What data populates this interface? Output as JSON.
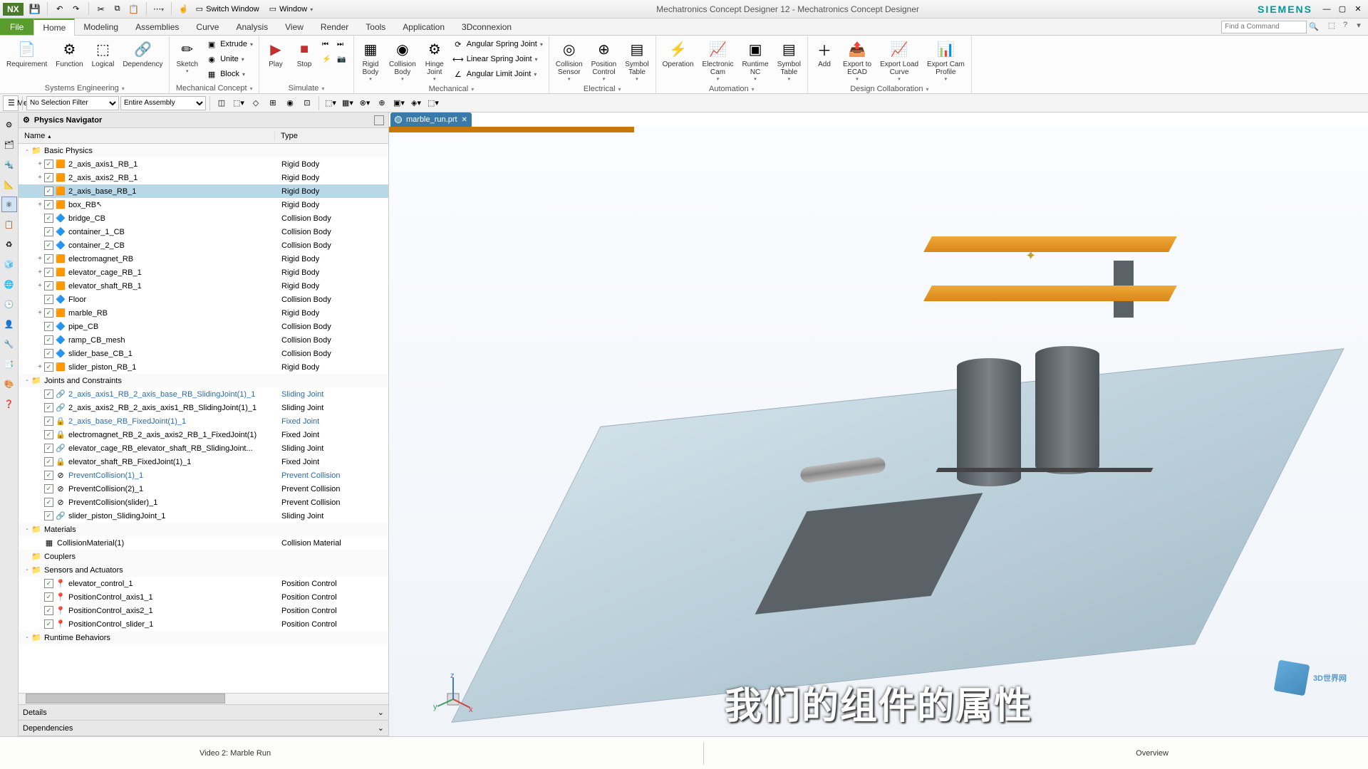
{
  "titlebar": {
    "logo": "NX",
    "switch_window": "Switch Window",
    "window_menu": "Window",
    "app_title": "Mechatronics Concept Designer 12 - Mechatronics Concept Designer",
    "brand": "SIEMENS"
  },
  "menu": {
    "file": "File",
    "tabs": [
      "Home",
      "Modeling",
      "Assemblies",
      "Curve",
      "Analysis",
      "View",
      "Render",
      "Tools",
      "Application",
      "3Dconnexion"
    ],
    "active_tab": "Home",
    "search_placeholder": "Find a Command"
  },
  "ribbon": {
    "groups": [
      {
        "title": "Systems Engineering",
        "buttons": [
          {
            "label": "Requirement",
            "icon": "📄"
          },
          {
            "label": "Function",
            "icon": "⚙"
          },
          {
            "label": "Logical",
            "icon": "⬚"
          },
          {
            "label": "Dependency",
            "icon": "🔗"
          }
        ]
      },
      {
        "title": "Mechanical Concept",
        "buttons": [
          {
            "label": "Sketch",
            "icon": "✏",
            "arrow": true
          }
        ],
        "smalls": [
          {
            "label": "Extrude",
            "icon": "▣"
          },
          {
            "label": "Unite",
            "icon": "◉"
          },
          {
            "label": "Block",
            "icon": "▦"
          }
        ]
      },
      {
        "title": "Simulate",
        "buttons": [
          {
            "label": "Play",
            "icon": "▶",
            "color": "#c03030"
          },
          {
            "label": "Stop",
            "icon": "■",
            "color": "#c03030"
          }
        ],
        "extra_icons": [
          "⏮",
          "⏭",
          "⚡",
          "📷"
        ]
      },
      {
        "title": "Mechanical",
        "buttons": [
          {
            "label": "Rigid\nBody",
            "icon": "▦",
            "arrow": true
          },
          {
            "label": "Collision\nBody",
            "icon": "◉",
            "arrow": true
          },
          {
            "label": "Hinge\nJoint",
            "icon": "⚙",
            "arrow": true
          }
        ],
        "smalls": [
          {
            "label": "Angular Spring Joint",
            "icon": "⟳"
          },
          {
            "label": "Linear Spring Joint",
            "icon": "⟷"
          },
          {
            "label": "Angular Limit Joint",
            "icon": "∠"
          }
        ]
      },
      {
        "title": "Electrical",
        "buttons": [
          {
            "label": "Collision\nSensor",
            "icon": "◎",
            "arrow": true
          },
          {
            "label": "Position\nControl",
            "icon": "⊕",
            "arrow": true
          },
          {
            "label": "Symbol\nTable",
            "icon": "▤",
            "arrow": true
          }
        ]
      },
      {
        "title": "Automation",
        "buttons": [
          {
            "label": "Operation",
            "icon": "⚡"
          },
          {
            "label": "Electronic\nCam",
            "icon": "📈",
            "arrow": true
          },
          {
            "label": "Runtime\nNC",
            "icon": "▣",
            "arrow": true
          },
          {
            "label": "Symbol\nTable",
            "icon": "▤",
            "arrow": true
          }
        ]
      },
      {
        "title": "Design Collaboration",
        "buttons": [
          {
            "label": "Add",
            "icon": "＋"
          },
          {
            "label": "Export to\nECAD",
            "icon": "📤",
            "arrow": true
          },
          {
            "label": "Export Load\nCurve",
            "icon": "📈",
            "arrow": true
          },
          {
            "label": "Export Cam\nProfile",
            "icon": "📊",
            "arrow": true
          }
        ]
      }
    ]
  },
  "subtoolbar": {
    "menu_label": "Menu",
    "filter": "No Selection Filter",
    "assembly": "Entire Assembly"
  },
  "navigator": {
    "title": "Physics Navigator",
    "col_name": "Name",
    "col_type": "Type",
    "details": "Details",
    "dependencies": "Dependencies",
    "tree": [
      {
        "kind": "folder",
        "name": "Basic Physics",
        "depth": 0,
        "expand": "-"
      },
      {
        "kind": "item",
        "name": "2_axis_axis1_RB_1",
        "type": "Rigid Body",
        "depth": 1,
        "icon": "🟧",
        "expand": "+"
      },
      {
        "kind": "item",
        "name": "2_axis_axis2_RB_1",
        "type": "Rigid Body",
        "depth": 1,
        "icon": "🟧",
        "expand": "+"
      },
      {
        "kind": "item",
        "name": "2_axis_base_RB_1",
        "type": "Rigid Body",
        "depth": 1,
        "icon": "🟧",
        "selected": true
      },
      {
        "kind": "item",
        "name": "box_RB",
        "type": "Rigid Body",
        "depth": 1,
        "icon": "🟧",
        "expand": "+",
        "cursor": true
      },
      {
        "kind": "item",
        "name": "bridge_CB",
        "type": "Collision Body",
        "depth": 1,
        "icon": "🔷"
      },
      {
        "kind": "item",
        "name": "container_1_CB",
        "type": "Collision Body",
        "depth": 1,
        "icon": "🔷"
      },
      {
        "kind": "item",
        "name": "container_2_CB",
        "type": "Collision Body",
        "depth": 1,
        "icon": "🔷"
      },
      {
        "kind": "item",
        "name": "electromagnet_RB",
        "type": "Rigid Body",
        "depth": 1,
        "icon": "🟧",
        "expand": "+"
      },
      {
        "kind": "item",
        "name": "elevator_cage_RB_1",
        "type": "Rigid Body",
        "depth": 1,
        "icon": "🟧",
        "expand": "+"
      },
      {
        "kind": "item",
        "name": "elevator_shaft_RB_1",
        "type": "Rigid Body",
        "depth": 1,
        "icon": "🟧",
        "expand": "+"
      },
      {
        "kind": "item",
        "name": "Floor",
        "type": "Collision Body",
        "depth": 1,
        "icon": "🔷"
      },
      {
        "kind": "item",
        "name": "marble_RB",
        "type": "Rigid Body",
        "depth": 1,
        "icon": "🟧",
        "expand": "+"
      },
      {
        "kind": "item",
        "name": "pipe_CB",
        "type": "Collision Body",
        "depth": 1,
        "icon": "🔷"
      },
      {
        "kind": "item",
        "name": "ramp_CB_mesh",
        "type": "Collision Body",
        "depth": 1,
        "icon": "🔷"
      },
      {
        "kind": "item",
        "name": "slider_base_CB_1",
        "type": "Collision Body",
        "depth": 1,
        "icon": "🔷"
      },
      {
        "kind": "item",
        "name": "slider_piston_RB_1",
        "type": "Rigid Body",
        "depth": 1,
        "icon": "🟧",
        "expand": "+"
      },
      {
        "kind": "folder",
        "name": "Joints and Constraints",
        "depth": 0,
        "expand": "-"
      },
      {
        "kind": "item",
        "name": "2_axis_axis1_RB_2_axis_base_RB_SlidingJoint(1)_1",
        "type": "Sliding Joint",
        "depth": 1,
        "icon": "🔗",
        "link": true
      },
      {
        "kind": "item",
        "name": "2_axis_axis2_RB_2_axis_axis1_RB_SlidingJoint(1)_1",
        "type": "Sliding Joint",
        "depth": 1,
        "icon": "🔗"
      },
      {
        "kind": "item",
        "name": "2_axis_base_RB_FixedJoint(1)_1",
        "type": "Fixed Joint",
        "depth": 1,
        "icon": "🔒",
        "link": true
      },
      {
        "kind": "item",
        "name": "electromagnet_RB_2_axis_axis2_RB_1_FixedJoint(1)",
        "type": "Fixed Joint",
        "depth": 1,
        "icon": "🔒"
      },
      {
        "kind": "item",
        "name": "elevator_cage_RB_elevator_shaft_RB_SlidingJoint...",
        "type": "Sliding Joint",
        "depth": 1,
        "icon": "🔗"
      },
      {
        "kind": "item",
        "name": "elevator_shaft_RB_FixedJoint(1)_1",
        "type": "Fixed Joint",
        "depth": 1,
        "icon": "🔒"
      },
      {
        "kind": "item",
        "name": "PreventCollision(1)_1",
        "type": "Prevent Collision",
        "depth": 1,
        "icon": "⊘",
        "link": true
      },
      {
        "kind": "item",
        "name": "PreventCollision(2)_1",
        "type": "Prevent Collision",
        "depth": 1,
        "icon": "⊘"
      },
      {
        "kind": "item",
        "name": "PreventCollision(slider)_1",
        "type": "Prevent Collision",
        "depth": 1,
        "icon": "⊘"
      },
      {
        "kind": "item",
        "name": "slider_piston_SlidingJoint_1",
        "type": "Sliding Joint",
        "depth": 1,
        "icon": "🔗"
      },
      {
        "kind": "folder",
        "name": "Materials",
        "depth": 0,
        "expand": "-"
      },
      {
        "kind": "item",
        "name": "CollisionMaterial(1)",
        "type": "Collision Material",
        "depth": 1,
        "icon": "▦",
        "nocheck": true
      },
      {
        "kind": "folder",
        "name": "Couplers",
        "depth": 0
      },
      {
        "kind": "folder",
        "name": "Sensors and Actuators",
        "depth": 0,
        "expand": "-"
      },
      {
        "kind": "item",
        "name": "elevator_control_1",
        "type": "Position Control",
        "depth": 1,
        "icon": "📍"
      },
      {
        "kind": "item",
        "name": "PositionControl_axis1_1",
        "type": "Position Control",
        "depth": 1,
        "icon": "📍"
      },
      {
        "kind": "item",
        "name": "PositionControl_axis2_1",
        "type": "Position Control",
        "depth": 1,
        "icon": "📍"
      },
      {
        "kind": "item",
        "name": "PositionControl_slider_1",
        "type": "Position Control",
        "depth": 1,
        "icon": "📍"
      },
      {
        "kind": "folder",
        "name": "Runtime Behaviors",
        "depth": 0,
        "expand": "-"
      }
    ]
  },
  "doc_tab": "marble_run.prt",
  "subtitle": "我们的组件的属性",
  "watermark": "3D世界网",
  "caption": {
    "left": "Video 2: Marble Run",
    "right": "Overview"
  }
}
